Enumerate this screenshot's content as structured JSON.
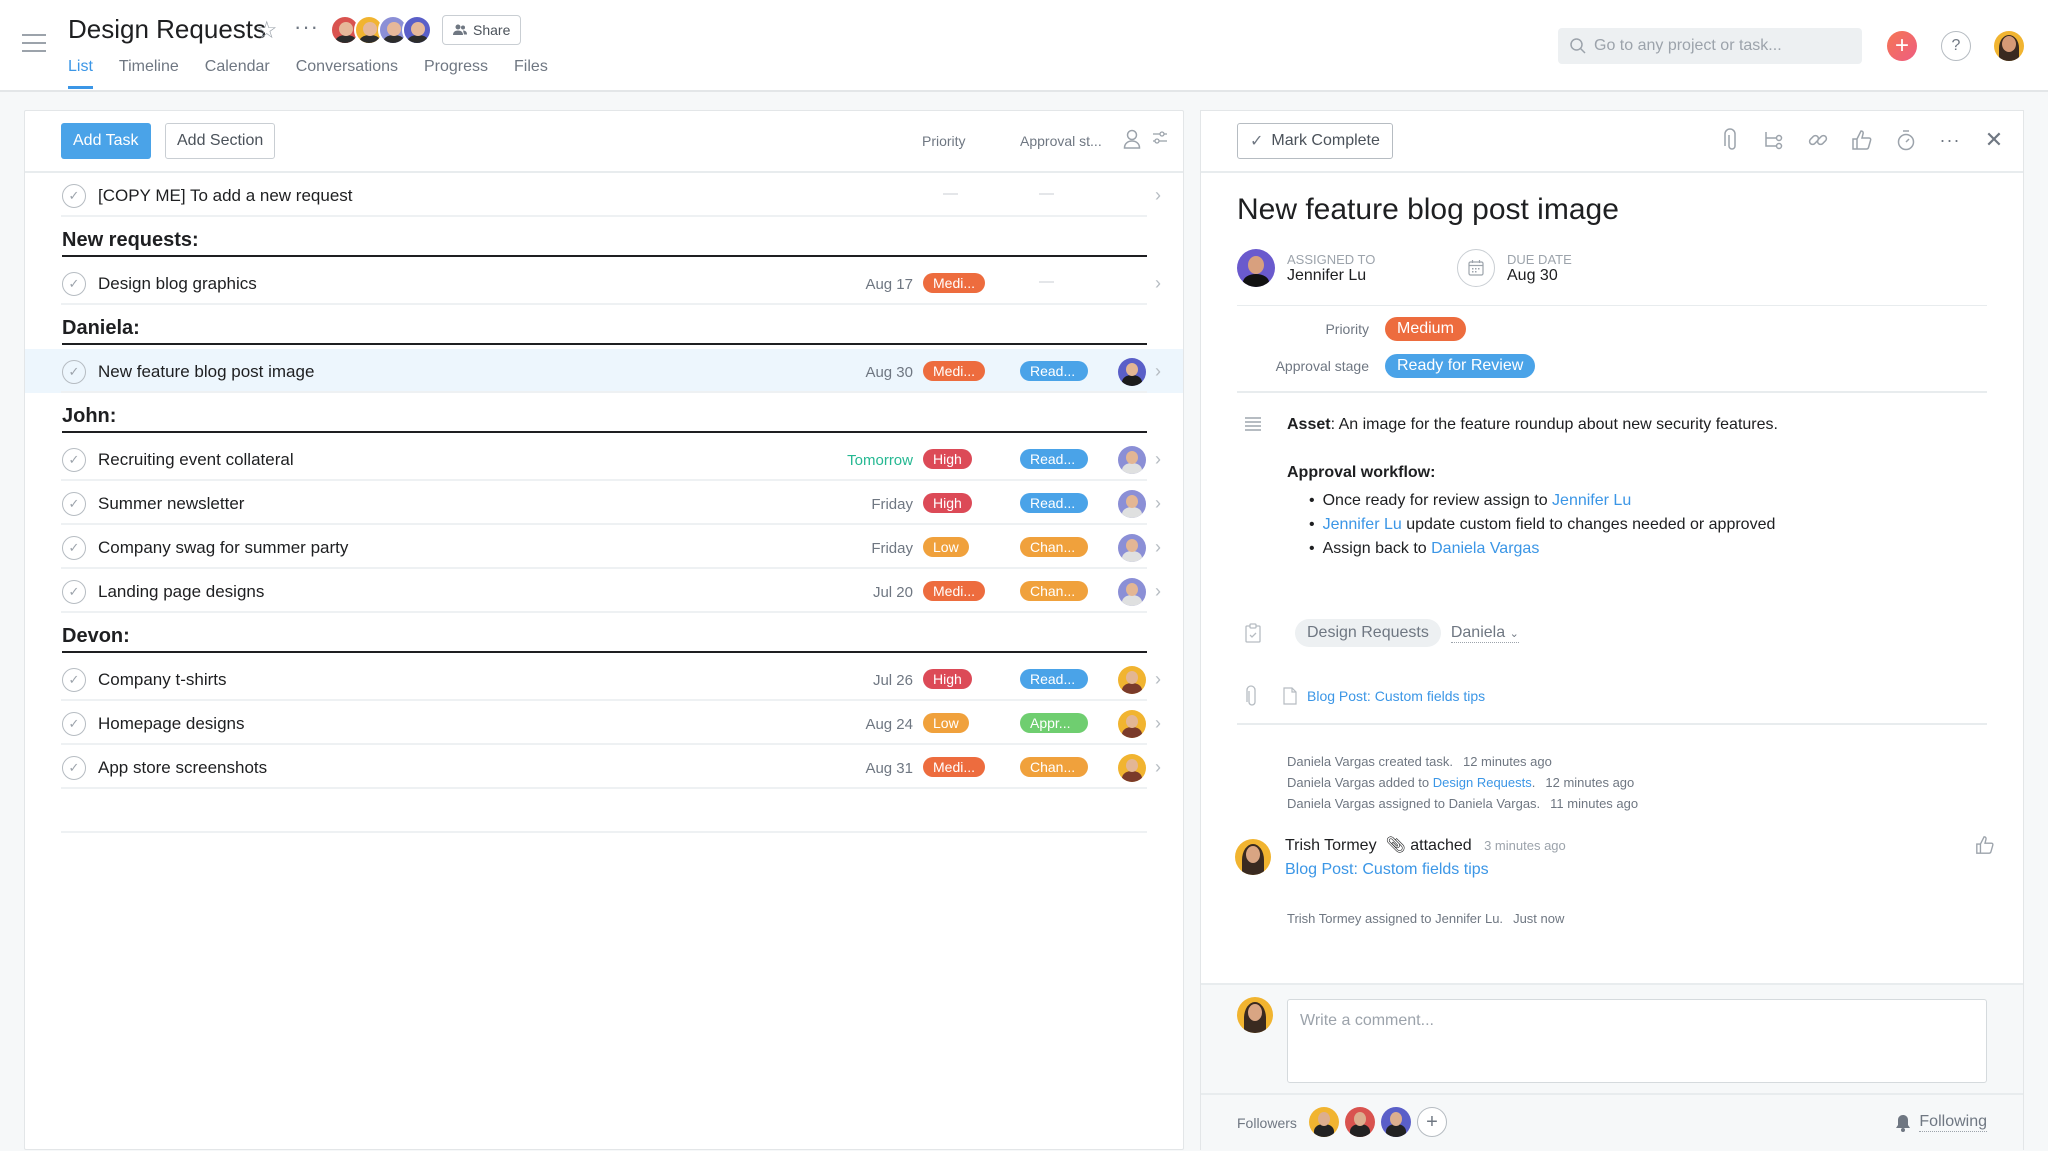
{
  "header": {
    "project_title": "Design Requests",
    "share_label": "Share",
    "tabs": [
      {
        "label": "List",
        "active": true
      },
      {
        "label": "Timeline",
        "active": false
      },
      {
        "label": "Calendar",
        "active": false
      },
      {
        "label": "Conversations",
        "active": false
      },
      {
        "label": "Progress",
        "active": false
      },
      {
        "label": "Files",
        "active": false
      }
    ],
    "search_placeholder": "Go to any project or task...",
    "help_label": "?",
    "member_colors": [
      "#d9534f",
      "#f1b430",
      "#8b8fd6",
      "#5a5fc8"
    ]
  },
  "list": {
    "add_task_label": "Add Task",
    "add_section_label": "Add Section",
    "col_priority": "Priority",
    "col_approval": "Approval st...",
    "empty_dash": "—",
    "rows": [
      {
        "type": "task",
        "name": "[COPY ME] To add a new request",
        "due": "",
        "priority": null,
        "approval": null,
        "assignee": null
      },
      {
        "type": "section",
        "name": "New requests:"
      },
      {
        "type": "task",
        "name": "Design blog graphics",
        "due": "Aug 17",
        "priority": "Medi...",
        "priority_color": "#ed6c3e",
        "approval": null,
        "assignee": null
      },
      {
        "type": "section",
        "name": "Daniela:"
      },
      {
        "type": "task",
        "name": "New feature blog post image",
        "due": "Aug 30",
        "priority": "Medi...",
        "priority_color": "#ed6c3e",
        "approval": "Read...",
        "approval_color": "#4aa3e8",
        "assignee": "jenny",
        "selected": true
      },
      {
        "type": "section",
        "name": "John:"
      },
      {
        "type": "task",
        "name": "Recruiting event collateral",
        "due": "Tomorrow",
        "due_soon": true,
        "priority": "High",
        "priority_color": "#dc4a57",
        "approval": "Read...",
        "approval_color": "#4aa3e8",
        "assignee": "john"
      },
      {
        "type": "task",
        "name": "Summer newsletter",
        "due": "Friday",
        "priority": "High",
        "priority_color": "#dc4a57",
        "approval": "Read...",
        "approval_color": "#4aa3e8",
        "assignee": "john"
      },
      {
        "type": "task",
        "name": "Company swag for summer party",
        "due": "Friday",
        "priority": "Low",
        "priority_color": "#f0a13c",
        "approval": "Chan...",
        "approval_color": "#f0a13c",
        "assignee": "john"
      },
      {
        "type": "task",
        "name": "Landing page designs",
        "due": "Jul 20",
        "priority": "Medi...",
        "priority_color": "#ed6c3e",
        "approval": "Chan...",
        "approval_color": "#f0a13c",
        "assignee": "john"
      },
      {
        "type": "section",
        "name": "Devon:"
      },
      {
        "type": "task",
        "name": "Company t-shirts",
        "due": "Jul 26",
        "priority": "High",
        "priority_color": "#dc4a57",
        "approval": "Read...",
        "approval_color": "#4aa3e8",
        "assignee": "trish"
      },
      {
        "type": "task",
        "name": "Homepage designs",
        "due": "Aug 24",
        "priority": "Low",
        "priority_color": "#f0a13c",
        "approval": "Appr...",
        "approval_color": "#6fce70",
        "assignee": "trish"
      },
      {
        "type": "task",
        "name": "App store screenshots",
        "due": "Aug 31",
        "priority": "Medi...",
        "priority_color": "#ed6c3e",
        "approval": "Chan...",
        "approval_color": "#f0a13c",
        "assignee": "trish"
      }
    ]
  },
  "detail": {
    "mark_complete_label": "Mark Complete",
    "title": "New feature blog post image",
    "assigned_to_label": "Assigned to",
    "assignee": "Jennifer Lu",
    "due_date_label": "Due date",
    "due_date": "Aug 30",
    "fields": [
      {
        "label": "Priority",
        "value": "Medium",
        "color": "#ed6c3e"
      },
      {
        "label": "Approval stage",
        "value": "Ready for Review",
        "color": "#4aa3e8"
      }
    ],
    "description": {
      "asset_label": "Asset",
      "asset_text": ": An image for the feature roundup about new security features.",
      "workflow_label": "Approval workflow:",
      "bullet1_text": "Once ready for review assign to ",
      "bullet1_link": "Jennifer Lu",
      "bullet2_link": "Jennifer Lu",
      "bullet2_text": " update custom field to changes needed or approved",
      "bullet3_text": "Assign back to ",
      "bullet3_link": "Daniela Vargas"
    },
    "project_chip": "Design Requests",
    "section_dropdown": "Daniela",
    "attachment": "Blog Post: Custom fields tips",
    "stories": [
      {
        "text": "Daniela Vargas created task.",
        "time": "12 minutes ago"
      },
      {
        "prefix": "Daniela Vargas added to ",
        "link": "Design Requests",
        "suffix": ".",
        "time": "12 minutes ago"
      },
      {
        "text": "Daniela Vargas assigned to Daniela Vargas.",
        "time": "11 minutes ago"
      }
    ],
    "comment": {
      "author": "Trish Tormey",
      "action": "attached",
      "time": "3 minutes ago",
      "link": "Blog Post: Custom fields tips"
    },
    "story_last": {
      "text": "Trish Tormey assigned to Jennifer Lu.",
      "time": "Just now"
    },
    "comment_placeholder": "Write a comment...",
    "followers_label": "Followers",
    "follower_colors": [
      "#f1b430",
      "#d9534f",
      "#5a5fc8"
    ],
    "following_label": "Following"
  }
}
